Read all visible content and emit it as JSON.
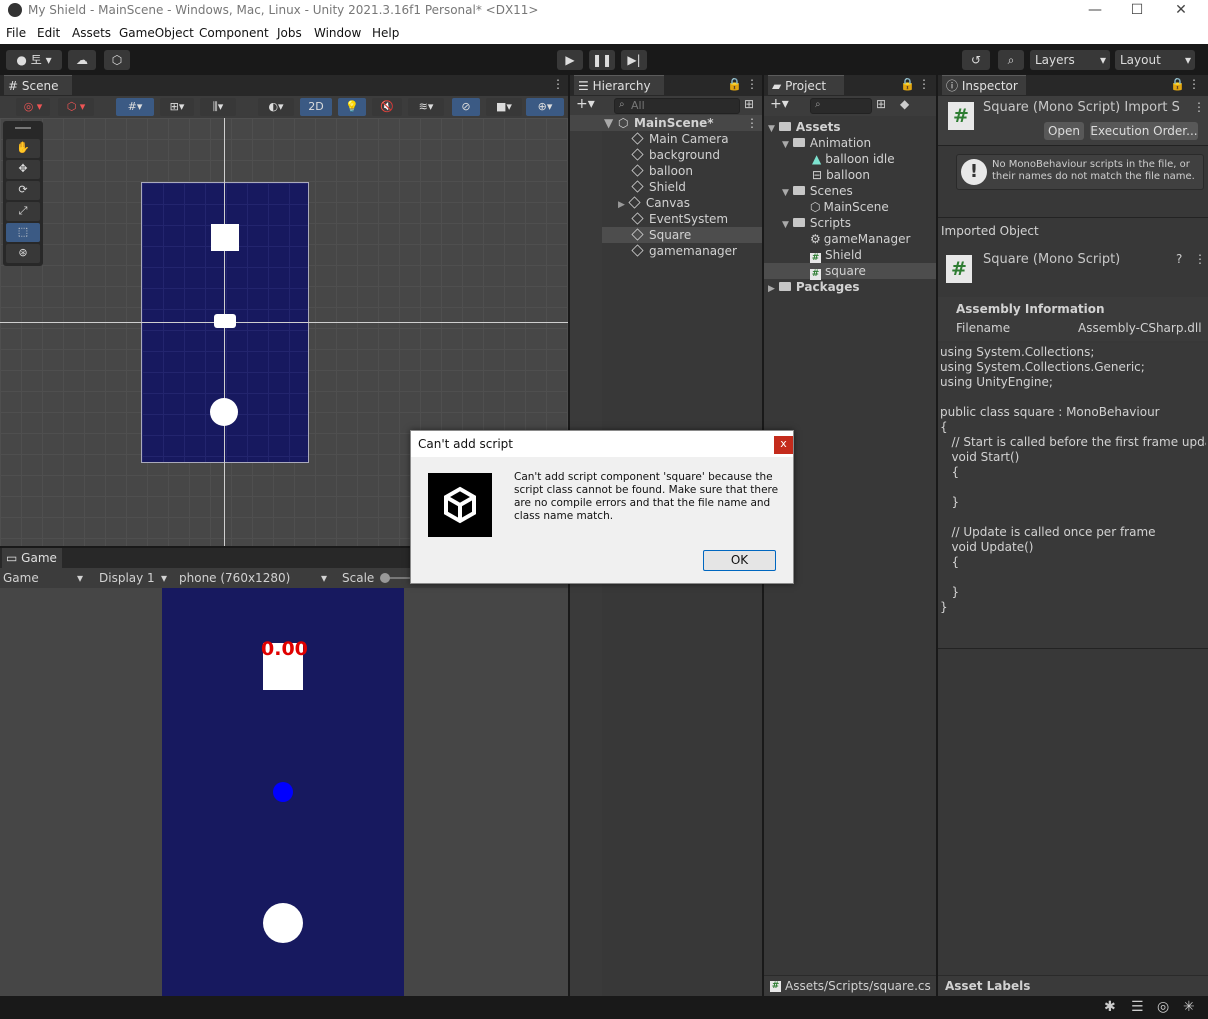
{
  "window": {
    "title": "My Shield - MainScene - Windows, Mac, Linux - Unity 2021.3.16f1 Personal* <DX11>",
    "minimize": "—",
    "maximize": "☐",
    "close": "✕"
  },
  "menu": [
    "File",
    "Edit",
    "Assets",
    "GameObject",
    "Component",
    "Jobs",
    "Window",
    "Help"
  ],
  "toolbar": {
    "account_label": "토",
    "layers_label": "Layers",
    "layout_label": "Layout"
  },
  "scene": {
    "tab": "Scene",
    "btn_2d": "2D"
  },
  "game": {
    "tab": "Game",
    "view_select": "Game",
    "display_select": "Display 1",
    "resolution_select": "phone (760x1280)",
    "scale_label": "Scale",
    "score_text": "0.00"
  },
  "hierarchy": {
    "tab": "Hierarchy",
    "search_placeholder": "All",
    "scene_name": "MainScene*",
    "items": [
      "Main Camera",
      "background",
      "balloon",
      "Shield",
      "Canvas",
      "EventSystem",
      "Square",
      "gamemanager"
    ]
  },
  "project": {
    "tab": "Project",
    "tree": {
      "assets": "Assets",
      "animation": "Animation",
      "balloon_idle": "balloon idle",
      "balloon": "balloon",
      "scenes": "Scenes",
      "mainscene": "MainScene",
      "scripts": "Scripts",
      "gamemanager": "gameManager",
      "shield": "Shield",
      "square": "square",
      "packages": "Packages"
    },
    "footer_path": "Assets/Scripts/square.cs"
  },
  "inspector": {
    "tab": "Inspector",
    "header_title": "Square (Mono Script) Import S",
    "open_btn": "Open",
    "exec_order_btn": "Execution Order...",
    "warning": "No MonoBehaviour scripts in the file, or their names do not match the file name.",
    "imported_object": "Imported Object",
    "object_title": "Square (Mono Script)",
    "assembly_info": "Assembly Information",
    "filename_label": "Filename",
    "filename_value": "Assembly-CSharp.dll",
    "code": "using System.Collections;\nusing System.Collections.Generic;\nusing UnityEngine;\n\npublic class square : MonoBehaviour\n{\n   // Start is called before the first frame update\n   void Start()\n   {\n\n   }\n\n   // Update is called once per frame\n   void Update()\n   {\n\n   }\n}",
    "asset_labels": "Asset Labels"
  },
  "dialog": {
    "title": "Can't add script",
    "close": "x",
    "message": "Can't add script component 'square' because the script class cannot be found. Make sure that there are no compile errors and that the file name and class name match.",
    "ok": "OK"
  }
}
